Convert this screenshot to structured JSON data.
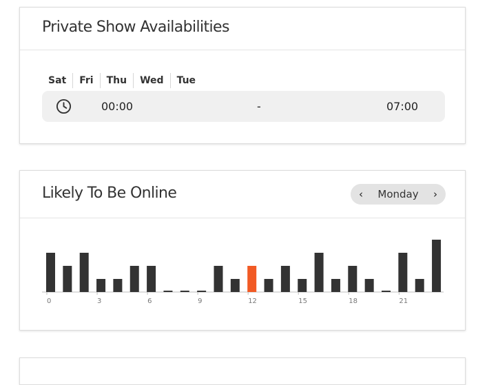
{
  "availability": {
    "title": "Private Show Availabilities",
    "days": [
      "Sat",
      "Fri",
      "Thu",
      "Wed",
      "Tue"
    ],
    "start_time": "00:00",
    "separator": "-",
    "end_time": "07:00",
    "icon": "clock-icon"
  },
  "online": {
    "title": "Likely To Be Online",
    "selected_day": "Monday",
    "prev_icon": "chevron-left-icon",
    "next_icon": "chevron-right-icon",
    "highlight_color": "#f15a24",
    "bar_color": "#333333"
  },
  "chart_data": {
    "type": "bar",
    "categories": [
      0,
      1,
      2,
      3,
      4,
      5,
      6,
      7,
      8,
      9,
      10,
      11,
      12,
      13,
      14,
      15,
      16,
      17,
      18,
      19,
      20,
      21,
      22,
      23
    ],
    "values": [
      3,
      2,
      3,
      1,
      1,
      2,
      2,
      0.1,
      0.1,
      0.1,
      2,
      1,
      2,
      1,
      2,
      1,
      3,
      1,
      2,
      1,
      0.1,
      3,
      1,
      4
    ],
    "highlight_index": 12,
    "tick_labels": [
      "0",
      "3",
      "6",
      "9",
      "12",
      "15",
      "18",
      "21"
    ],
    "tick_positions": [
      0,
      3,
      6,
      9,
      12,
      15,
      18,
      21
    ],
    "ylim": [
      0,
      4
    ],
    "xlabel": "",
    "ylabel": "",
    "title": ""
  }
}
